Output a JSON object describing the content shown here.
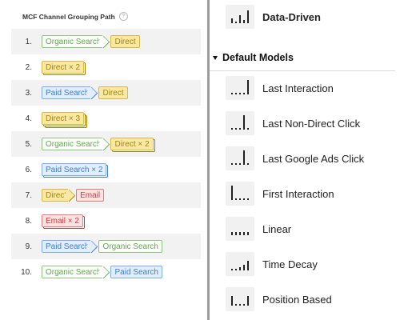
{
  "left_panel": {
    "header": "MCF Channel Grouping Path",
    "help_glyph": "?",
    "rows": [
      {
        "num": "1.",
        "chips": [
          {
            "label": "Organic Search",
            "kind": "organic",
            "arrow": true
          },
          {
            "label": "Direct",
            "kind": "direct"
          }
        ]
      },
      {
        "num": "2.",
        "chips": [
          {
            "label": "Direct × 2",
            "kind": "direct",
            "stack": 1
          }
        ]
      },
      {
        "num": "3.",
        "chips": [
          {
            "label": "Paid Search",
            "kind": "paid",
            "arrow": true
          },
          {
            "label": "Direct",
            "kind": "direct"
          }
        ]
      },
      {
        "num": "4.",
        "chips": [
          {
            "label": "Direct × 3",
            "kind": "direct",
            "stack": 2
          }
        ]
      },
      {
        "num": "5.",
        "chips": [
          {
            "label": "Organic Search",
            "kind": "organic",
            "arrow": true
          },
          {
            "label": "Direct × 2",
            "kind": "direct",
            "stack": 1
          }
        ]
      },
      {
        "num": "6.",
        "chips": [
          {
            "label": "Paid Search × 2",
            "kind": "paid",
            "stack": 1
          }
        ]
      },
      {
        "num": "7.",
        "chips": [
          {
            "label": "Direct",
            "kind": "direct",
            "arrow": true
          },
          {
            "label": "Email",
            "kind": "email"
          }
        ]
      },
      {
        "num": "8.",
        "chips": [
          {
            "label": "Email × 2",
            "kind": "email",
            "stack": 1
          }
        ]
      },
      {
        "num": "9.",
        "chips": [
          {
            "label": "Paid Search",
            "kind": "paid",
            "arrow": true
          },
          {
            "label": "Organic Search",
            "kind": "organic"
          }
        ]
      },
      {
        "num": "10.",
        "chips": [
          {
            "label": "Organic Search",
            "kind": "organic",
            "arrow": true
          },
          {
            "label": "Paid Search",
            "kind": "paid"
          }
        ]
      }
    ]
  },
  "right_panel": {
    "top_model": {
      "label": "Data-Driven",
      "icon": "data-driven-icon",
      "bold": true
    },
    "section_title": "Default Models",
    "models": [
      {
        "label": "Last Interaction",
        "icon": "last-interaction-icon",
        "bars": [
          1,
          1,
          1,
          1,
          18
        ]
      },
      {
        "label": "Last Non-Direct Click",
        "icon": "last-non-direct-click-icon",
        "bars": [
          1,
          1,
          1,
          18,
          1
        ]
      },
      {
        "label": "Last Google Ads Click",
        "icon": "last-google-ads-click-icon",
        "bars": [
          1,
          1,
          1,
          18,
          1
        ]
      },
      {
        "label": "First Interaction",
        "icon": "first-interaction-icon",
        "bars": [
          18,
          1,
          1,
          1,
          1
        ]
      },
      {
        "label": "Linear",
        "icon": "linear-icon",
        "bars": [
          4,
          4,
          4,
          4,
          4
        ]
      },
      {
        "label": "Time Decay",
        "icon": "time-decay-icon",
        "bars": [
          1,
          2,
          4,
          7,
          12
        ]
      },
      {
        "label": "Position Based",
        "icon": "position-based-icon",
        "bars": [
          12,
          2,
          2,
          2,
          12
        ]
      }
    ]
  }
}
